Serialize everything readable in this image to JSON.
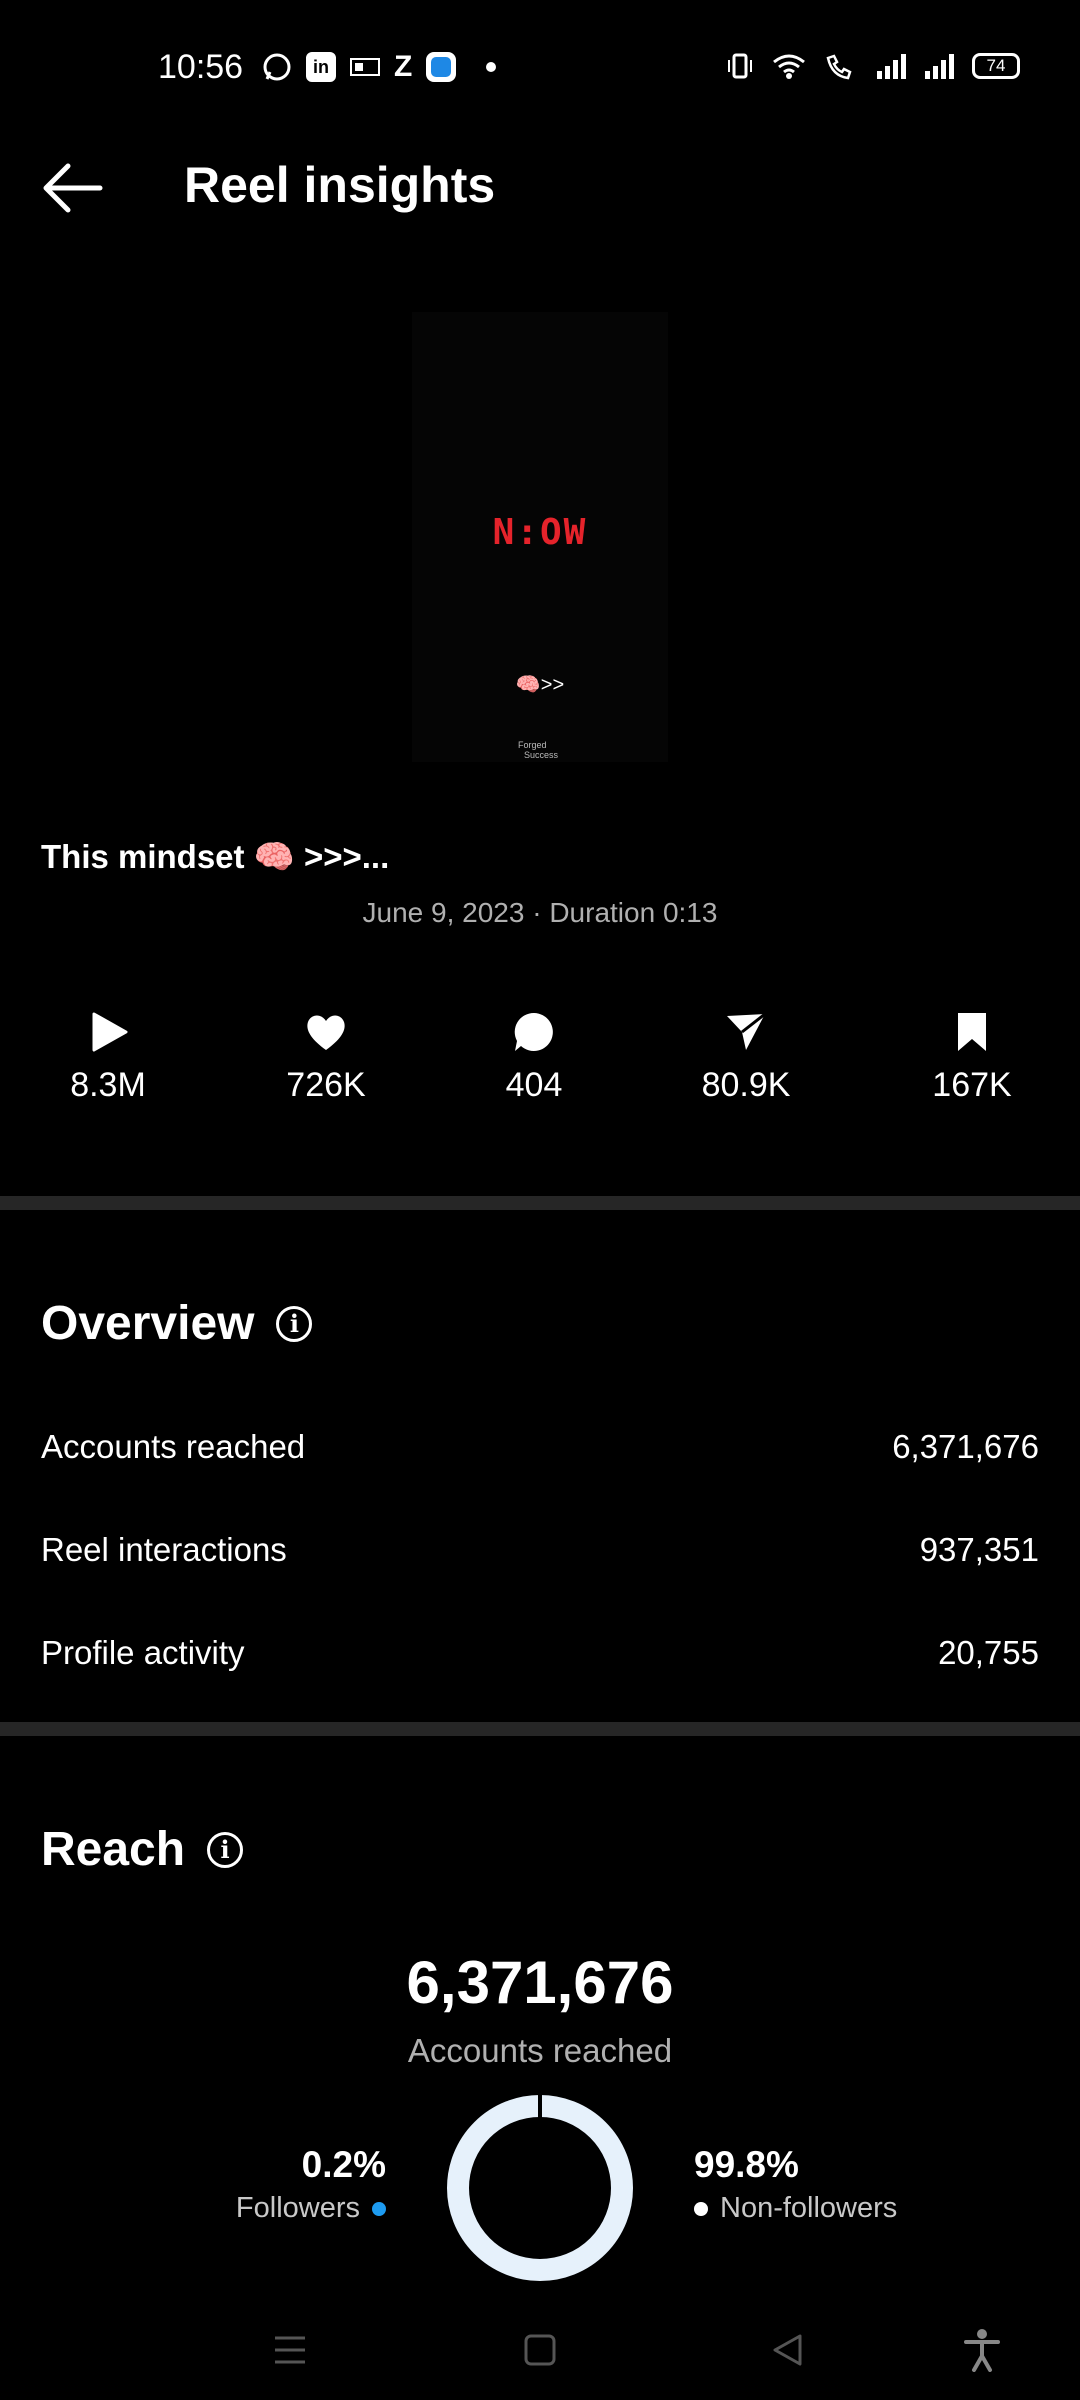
{
  "status": {
    "time": "10:56",
    "battery": "74",
    "icons": [
      "whatsapp-icon",
      "linkedin-icon",
      "app-icon",
      "z-icon",
      "app-blue-icon"
    ]
  },
  "header": {
    "title": "Reel insights",
    "back_icon": "arrow-left-icon"
  },
  "reel": {
    "thumb_text": "N:OW",
    "thumb_emoji": "🧠>>",
    "thumb_brand_1": "Forged",
    "thumb_brand_2": "Success",
    "caption": "This mindset 🧠 >>>...",
    "meta": "June 9, 2023 · Duration 0:13"
  },
  "stats": [
    {
      "icon": "play-icon",
      "value": "8.3M"
    },
    {
      "icon": "heart-icon",
      "value": "726K"
    },
    {
      "icon": "comment-icon",
      "value": "404"
    },
    {
      "icon": "send-icon",
      "value": "80.9K"
    },
    {
      "icon": "bookmark-icon",
      "value": "167K"
    }
  ],
  "overview": {
    "title": "Overview",
    "rows": [
      {
        "label": "Accounts reached",
        "value": "6,371,676"
      },
      {
        "label": "Reel interactions",
        "value": "937,351"
      },
      {
        "label": "Profile activity",
        "value": "20,755"
      }
    ]
  },
  "reach": {
    "title": "Reach",
    "total": "6,371,676",
    "total_label": "Accounts reached",
    "followers_pct": "0.2%",
    "followers_label": "Followers",
    "nonfollowers_pct": "99.8%",
    "nonfollowers_label": "Non-followers",
    "followers_fraction": 0.002,
    "colors": {
      "followers": "#1d9bf0",
      "nonfollowers": "#e6f1fb"
    }
  }
}
